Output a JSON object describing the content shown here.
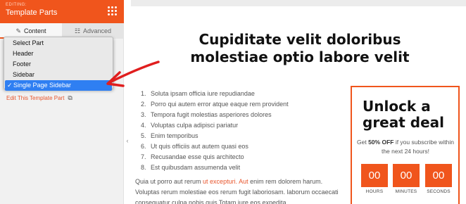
{
  "panel": {
    "editing_label": "EDITING:",
    "title": "Template Parts",
    "header_color": "#f0551c",
    "tabs": [
      {
        "label": "Content",
        "icon": "pencil-icon"
      },
      {
        "label": "Advanced",
        "icon": "sliders-icon"
      }
    ],
    "dropdown": {
      "options": [
        "Select Part",
        "Header",
        "Footer",
        "Sidebar",
        "Single Page Sidebar"
      ],
      "selected": "Single Page Sidebar",
      "check": "✓"
    },
    "edit_link": "Edit This Template Part"
  },
  "preview": {
    "headline": "Cupiditate velit doloribus molestiae optio labore velit",
    "list": [
      {
        "num": "1.",
        "text": "Soluta ipsam officia iure repudiandae"
      },
      {
        "num": "2.",
        "text": "Porro qui autem error atque eaque rem provident"
      },
      {
        "num": "3.",
        "text": "Tempora fugit molestias asperiores dolores"
      },
      {
        "num": "4.",
        "text": "Voluptas culpa adipisci pariatur"
      },
      {
        "num": "5.",
        "text": "Enim temporibus"
      },
      {
        "num": "6.",
        "text": "Ut quis officiis aut autem quasi eos"
      },
      {
        "num": "7.",
        "text": "Recusandae esse quis architecto"
      },
      {
        "num": "8.",
        "text": "Est quibusdam assumenda velit"
      }
    ],
    "paragraph": {
      "part1": "Quia ut porro aut rerum ",
      "accent1": "ut excepturi.",
      "part2": " ",
      "accent2": "Aut",
      "part3": " enim rem dolorem harum. Voluptas rerum molestiae eos rerum fugit laboriosam. laborum occaecati consequatur culpa nobis quis Totam iure eos expedita."
    },
    "cta": {
      "title": "Unlock a great deal",
      "text_before": "Get ",
      "text_bold": "50% OFF",
      "text_after": " if you subscribe within the next 24 hours!",
      "counters": [
        {
          "value": "00",
          "label": "HOURS"
        },
        {
          "value": "00",
          "label": "MINUTES"
        },
        {
          "value": "00",
          "label": "SECONDS"
        }
      ]
    }
  }
}
